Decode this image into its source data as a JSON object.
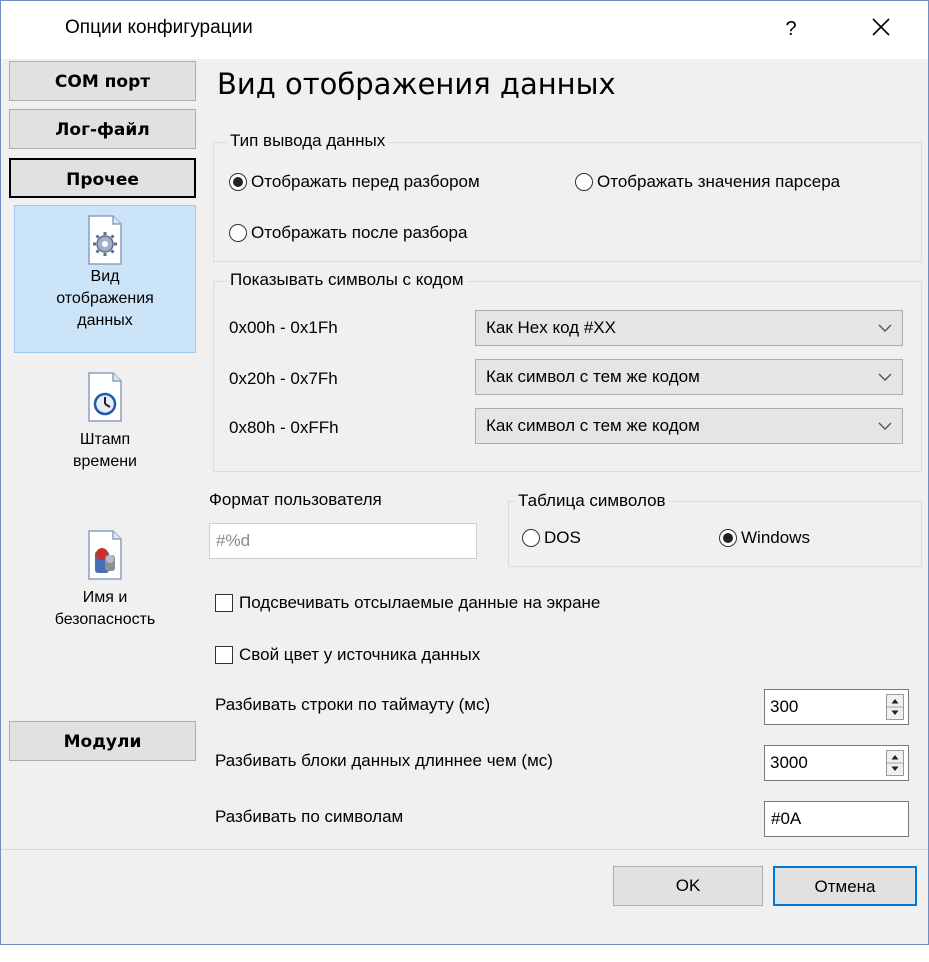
{
  "window": {
    "title": "Опции конфигурации",
    "help": "?",
    "close_icon": "close-icon"
  },
  "nav": {
    "com_port": "COM порт",
    "log_file": "Лог-файл",
    "other": "Прочее",
    "modules": "Модули",
    "items": [
      {
        "line1": "Вид",
        "line2": "отображения",
        "line3": "данных",
        "icon": "gear-document-icon"
      },
      {
        "line1": "Штамп",
        "line2": "времени",
        "icon": "clock-document-icon"
      },
      {
        "line1": "Имя и",
        "line2": "безопасность",
        "icon": "keys-document-icon"
      }
    ]
  },
  "page": {
    "title": "Вид отображения данных"
  },
  "output_type": {
    "label": "Тип вывода данных",
    "opt_before": "Отображать перед разбором",
    "opt_parser": "Отображать значения парсера",
    "opt_after": "Отображать после разбора",
    "selected": "opt_before"
  },
  "symbols": {
    "label": "Показывать символы с кодом",
    "rows": [
      {
        "range": "0x00h - 0x1Fh",
        "value": "Как Hex код #XX"
      },
      {
        "range": "0x20h - 0x7Fh",
        "value": "Как символ с тем же кодом"
      },
      {
        "range": "0x80h - 0xFFh",
        "value": "Как символ с тем же кодом"
      }
    ]
  },
  "user_format": {
    "label": "Формат пользователя",
    "value": "#%d"
  },
  "charset": {
    "label": "Таблица символов",
    "dos": "DOS",
    "windows": "Windows",
    "selected": "windows"
  },
  "checks": {
    "highlight_sent": "Подсвечивать отсылаемые данные на экране",
    "own_color": "Свой цвет у источника данных"
  },
  "split": {
    "timeout_label": "Разбивать строки по таймауту (мс)",
    "timeout_value": "300",
    "blocks_label": "Разбивать блоки данных длиннее чем (мс)",
    "blocks_value": "3000",
    "chars_label": "Разбивать по символам",
    "chars_value": "#0A"
  },
  "buttons": {
    "ok": "OK",
    "cancel": "Отмена"
  }
}
